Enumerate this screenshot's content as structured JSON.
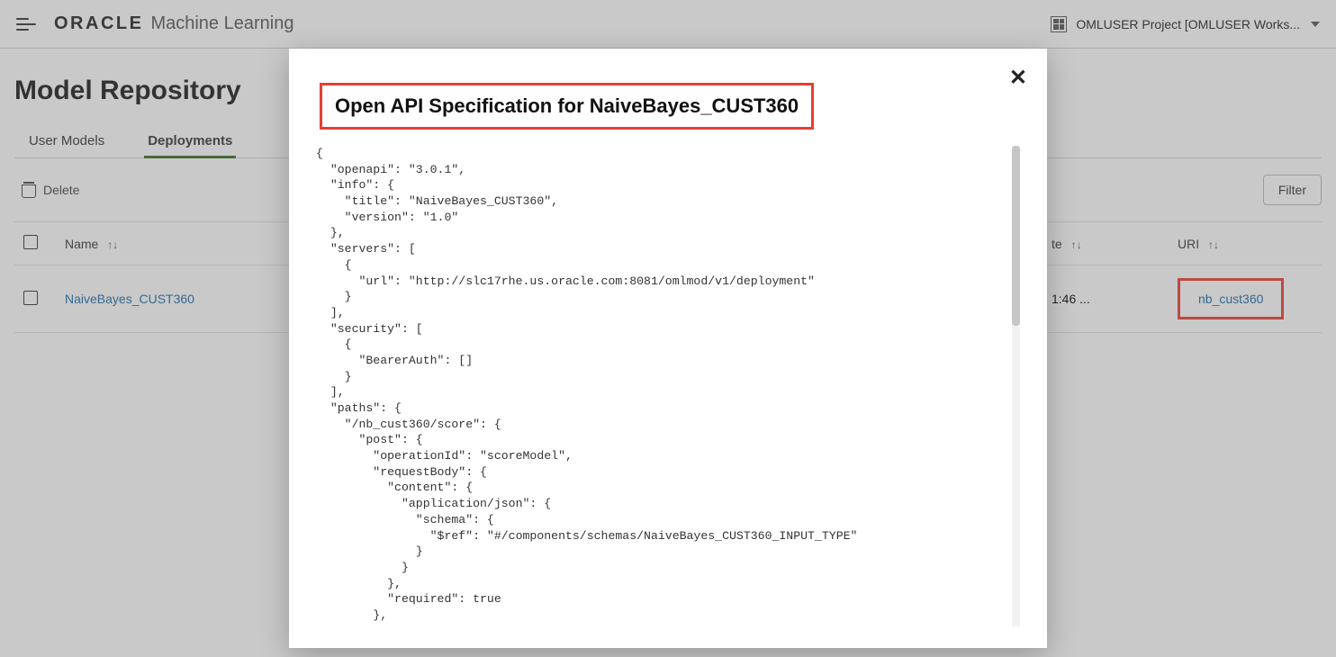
{
  "header": {
    "brand_oracle": "ORACLE",
    "brand_ml": "Machine Learning",
    "project_label": "OMLUSER Project [OMLUSER Works..."
  },
  "page": {
    "title": "Model Repository",
    "tabs": [
      "User Models",
      "Deployments"
    ],
    "active_tab": 1,
    "delete_label": "Delete",
    "filter_label": "Filter"
  },
  "table": {
    "columns": {
      "name": "Name",
      "date": "te",
      "uri": "URI"
    },
    "rows": [
      {
        "name": "NaiveBayes_CUST360",
        "date": "1:46 ...",
        "uri": "nb_cust360"
      }
    ]
  },
  "modal": {
    "title": "Open API Specification for NaiveBayes_CUST360",
    "code": "{\n  \"openapi\": \"3.0.1\",\n  \"info\": {\n    \"title\": \"NaiveBayes_CUST360\",\n    \"version\": \"1.0\"\n  },\n  \"servers\": [\n    {\n      \"url\": \"http://slc17rhe.us.oracle.com:8081/omlmod/v1/deployment\"\n    }\n  ],\n  \"security\": [\n    {\n      \"BearerAuth\": []\n    }\n  ],\n  \"paths\": {\n    \"/nb_cust360/score\": {\n      \"post\": {\n        \"operationId\": \"scoreModel\",\n        \"requestBody\": {\n          \"content\": {\n            \"application/json\": {\n              \"schema\": {\n                \"$ref\": \"#/components/schemas/NaiveBayes_CUST360_INPUT_TYPE\"\n              }\n            }\n          },\n          \"required\": true\n        },"
  }
}
